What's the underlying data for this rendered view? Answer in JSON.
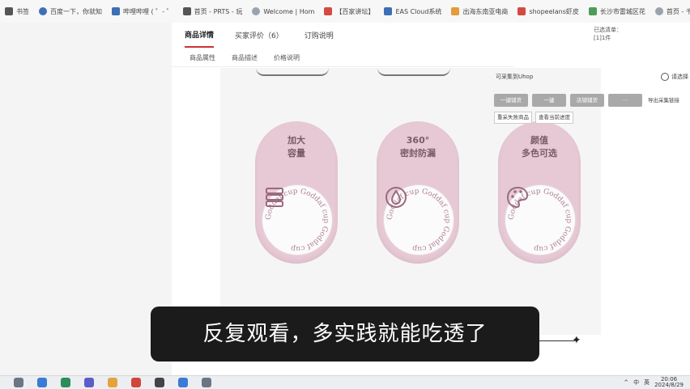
{
  "bookmarks": [
    {
      "label": "书签",
      "icon": "folder-icon"
    },
    {
      "label": "百度一下，你就知",
      "icon": "baidu-icon"
    },
    {
      "label": "哔哩哔哩 ( ゜- ゜",
      "icon": "bilibili-icon"
    },
    {
      "label": "首页 - PRTS - 玩",
      "icon": "prts-icon"
    },
    {
      "label": "Welcome | Hom",
      "icon": "globe-icon"
    },
    {
      "label": "【百家讲坛】",
      "icon": "video-icon"
    },
    {
      "label": "EAS Cloud系统",
      "icon": "cloud-icon"
    },
    {
      "label": "出海东南亚电商",
      "icon": "shop-icon"
    },
    {
      "label": "shopeelans虾皮",
      "icon": "shopee-icon"
    },
    {
      "label": "长沙市雷城区花",
      "icon": "map-icon"
    },
    {
      "label": "首页 - 千帆供应",
      "icon": "supply-icon"
    }
  ],
  "main": {
    "tabs": [
      "商品详情",
      "买家评价（6）",
      "订购说明"
    ],
    "subtabs": [
      "商品属性",
      "商品描述",
      "价格说明"
    ],
    "selected_info": {
      "line1": "已选清单：",
      "line2": "[1]1件"
    },
    "uhop_label": "可采集到Uhop",
    "settings_label": "请选择",
    "buttons": [
      "一键铺货",
      "一键",
      "店铺铺货",
      "···",
      "导出采集链接"
    ],
    "buttons2": [
      "重采失败商品",
      "查看当前进度"
    ]
  },
  "pills": [
    {
      "line1": "加大",
      "line2": "容量",
      "icon": "storage-icon"
    },
    {
      "line1": "360°",
      "line2": "密封防漏",
      "icon": "droplet-icon"
    },
    {
      "line1": "颜值",
      "line2": "多色可选",
      "icon": "palette-icon"
    }
  ],
  "pill_ring_text": "Goddaf cup Goddaf cup Goddaf cup ",
  "caption": "反复观看，多实践就能吃透了",
  "taskbar": {
    "tray": [
      "^",
      "中",
      "英"
    ],
    "time": "20:06",
    "date": "2024/8/29"
  },
  "colors": {
    "pill": "#e7c9d5",
    "pill_text": "#7a5a66",
    "caption_bg": "#1b1b1b",
    "button_gray": "#a9a9a9"
  }
}
